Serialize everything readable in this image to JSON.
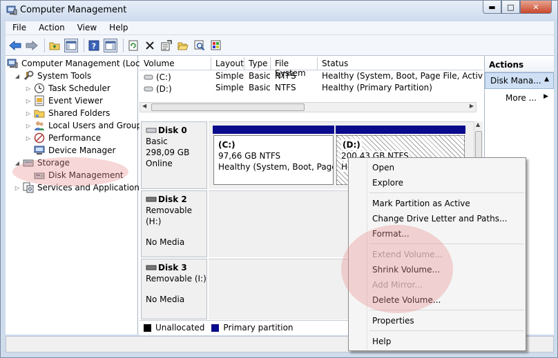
{
  "window": {
    "title": "Computer Management",
    "controls": [
      "minimize",
      "maximize",
      "close"
    ]
  },
  "menubar": [
    "File",
    "Action",
    "View",
    "Help"
  ],
  "toolbar": [
    "back-arrow-icon",
    "forward-arrow-icon",
    "up-folder-icon",
    "show-hide-tree-icon",
    "help-icon",
    "show-hide-action-pane-icon",
    "refresh-icon",
    "delete-icon",
    "properties-icon",
    "open-folder-icon",
    "search-icon",
    "export-icon"
  ],
  "tree": {
    "root": "Computer Management (Local",
    "system_tools": "System Tools",
    "task_scheduler": "Task Scheduler",
    "event_viewer": "Event Viewer",
    "shared_folders": "Shared Folders",
    "local_users": "Local Users and Groups",
    "performance": "Performance",
    "device_manager": "Device Manager",
    "storage": "Storage",
    "disk_management": "Disk Management",
    "services": "Services and Applications"
  },
  "volumes": {
    "columns": [
      "Volume",
      "Layout",
      "Type",
      "File System",
      "Status"
    ],
    "rows": [
      [
        "(C:)",
        "Simple",
        "Basic",
        "NTFS",
        "Healthy (System, Boot, Page File, Active, Cr"
      ],
      [
        "(D:)",
        "Simple",
        "Basic",
        "NTFS",
        "Healthy (Primary Partition)"
      ]
    ]
  },
  "disks": [
    {
      "name": "Disk 0",
      "lines": [
        "Basic",
        "298,09 GB",
        "Online"
      ]
    },
    {
      "name": "Disk 2",
      "lines": [
        "Removable (H:)",
        "",
        "No Media"
      ]
    },
    {
      "name": "Disk 3",
      "lines": [
        "Removable (I:)",
        "",
        "No Media"
      ]
    }
  ],
  "partitions": {
    "c": {
      "label": "(C:)",
      "size": "97,66 GB NTFS",
      "status": "Healthy (System, Boot, Page Fi"
    },
    "d": {
      "label": "(D:)",
      "size": "200,43 GB NTFS",
      "status": "He"
    }
  },
  "legend": {
    "unallocated": "Unallocated",
    "primary": "Primary partition",
    "unallocated_color": "#000000",
    "primary_color": "#0a0a8c"
  },
  "actions": {
    "header": "Actions",
    "section": "Disk Mana...",
    "more": "More ..."
  },
  "context_menu": {
    "open": "Open",
    "explore": "Explore",
    "mark_active": "Mark Partition as Active",
    "change_letter": "Change Drive Letter and Paths...",
    "format": "Format...",
    "extend": "Extend Volume...",
    "shrink": "Shrink Volume...",
    "add_mirror": "Add Mirror...",
    "delete": "Delete Volume...",
    "properties": "Properties",
    "help": "Help"
  }
}
